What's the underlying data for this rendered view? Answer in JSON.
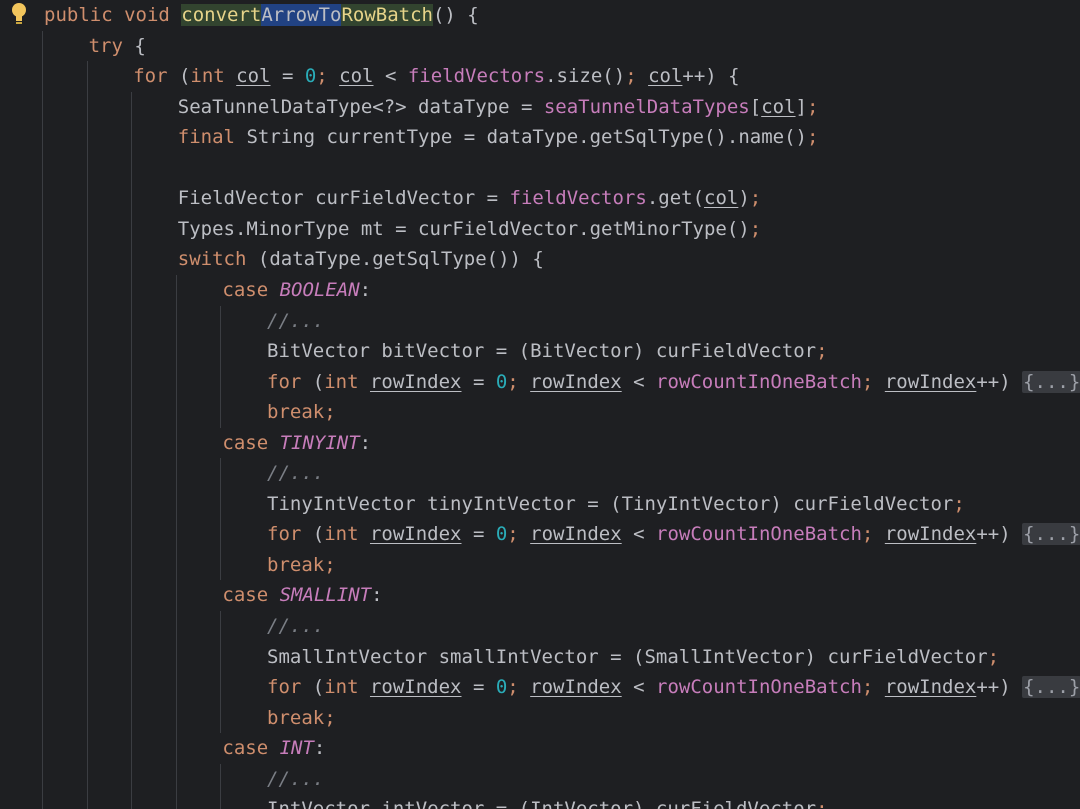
{
  "editor": {
    "lines": [
      {
        "indent": 0,
        "tokens": [
          {
            "t": "public ",
            "c": "kw"
          },
          {
            "t": "void ",
            "c": "kw"
          },
          {
            "t": "convert",
            "c": "m1"
          },
          {
            "t": "ArrowTo",
            "c": "sel"
          },
          {
            "t": "RowBatch",
            "c": "m1"
          },
          {
            "t": "() {",
            "c": ""
          }
        ]
      },
      {
        "indent": 1,
        "tokens": [
          {
            "t": "try ",
            "c": "kw"
          },
          {
            "t": "{",
            "c": ""
          }
        ]
      },
      {
        "indent": 2,
        "tokens": [
          {
            "t": "for ",
            "c": "kw"
          },
          {
            "t": "(",
            "c": ""
          },
          {
            "t": "int ",
            "c": "kw"
          },
          {
            "t": "col",
            "c": "var"
          },
          {
            "t": " = ",
            "c": ""
          },
          {
            "t": "0",
            "c": "num"
          },
          {
            "t": "; ",
            "c": "kw"
          },
          {
            "t": "col",
            "c": "var"
          },
          {
            "t": " < ",
            "c": ""
          },
          {
            "t": "fieldVectors",
            "c": "fld"
          },
          {
            "t": ".size()",
            "c": ""
          },
          {
            "t": "; ",
            "c": "kw"
          },
          {
            "t": "col",
            "c": "var"
          },
          {
            "t": "++) {",
            "c": ""
          }
        ]
      },
      {
        "indent": 3,
        "tokens": [
          {
            "t": "SeaTunnelDataType<?> dataType = ",
            "c": ""
          },
          {
            "t": "seaTunnelDataTypes",
            "c": "fld"
          },
          {
            "t": "[",
            "c": ""
          },
          {
            "t": "col",
            "c": "var"
          },
          {
            "t": "]",
            "c": ""
          },
          {
            "t": ";",
            "c": "kw"
          }
        ]
      },
      {
        "indent": 3,
        "tokens": [
          {
            "t": "final ",
            "c": "kw"
          },
          {
            "t": "String currentType = dataType.getSqlType().name()",
            "c": ""
          },
          {
            "t": ";",
            "c": "kw"
          }
        ]
      },
      {
        "indent": 3,
        "tokens": []
      },
      {
        "indent": 3,
        "tokens": [
          {
            "t": "FieldVector curFieldVector = ",
            "c": ""
          },
          {
            "t": "fieldVectors",
            "c": "fld"
          },
          {
            "t": ".get(",
            "c": ""
          },
          {
            "t": "col",
            "c": "var"
          },
          {
            "t": ")",
            "c": ""
          },
          {
            "t": ";",
            "c": "kw"
          }
        ]
      },
      {
        "indent": 3,
        "tokens": [
          {
            "t": "Types.MinorType mt = curFieldVector.getMinorType()",
            "c": ""
          },
          {
            "t": ";",
            "c": "kw"
          }
        ]
      },
      {
        "indent": 3,
        "tokens": [
          {
            "t": "switch ",
            "c": "kw"
          },
          {
            "t": "(dataType.getSqlType()) {",
            "c": ""
          }
        ]
      },
      {
        "indent": 4,
        "tokens": [
          {
            "t": "case ",
            "c": "kw"
          },
          {
            "t": "BOOLEAN",
            "c": "enum"
          },
          {
            "t": ":",
            "c": ""
          }
        ]
      },
      {
        "indent": 5,
        "tokens": [
          {
            "t": "//...",
            "c": "cmt"
          }
        ]
      },
      {
        "indent": 5,
        "tokens": [
          {
            "t": "BitVector bitVector = (BitVector) curFieldVector",
            "c": ""
          },
          {
            "t": ";",
            "c": "kw"
          }
        ]
      },
      {
        "indent": 5,
        "tokens": [
          {
            "t": "for ",
            "c": "kw"
          },
          {
            "t": "(",
            "c": ""
          },
          {
            "t": "int ",
            "c": "kw"
          },
          {
            "t": "rowIndex",
            "c": "var"
          },
          {
            "t": " = ",
            "c": ""
          },
          {
            "t": "0",
            "c": "num"
          },
          {
            "t": "; ",
            "c": "kw"
          },
          {
            "t": "rowIndex",
            "c": "var"
          },
          {
            "t": " < ",
            "c": ""
          },
          {
            "t": "rowCountInOneBatch",
            "c": "fld"
          },
          {
            "t": "; ",
            "c": "kw"
          },
          {
            "t": "rowIndex",
            "c": "var"
          },
          {
            "t": "++) ",
            "c": ""
          },
          {
            "t": "{...}",
            "c": "fold"
          }
        ]
      },
      {
        "indent": 5,
        "tokens": [
          {
            "t": "break",
            "c": "kw"
          },
          {
            "t": ";",
            "c": "kw"
          }
        ]
      },
      {
        "indent": 4,
        "tokens": [
          {
            "t": "case ",
            "c": "kw"
          },
          {
            "t": "TINYINT",
            "c": "enum"
          },
          {
            "t": ":",
            "c": ""
          }
        ]
      },
      {
        "indent": 5,
        "tokens": [
          {
            "t": "//...",
            "c": "cmt"
          }
        ]
      },
      {
        "indent": 5,
        "tokens": [
          {
            "t": "TinyIntVector tinyIntVector = (TinyIntVector) curFieldVector",
            "c": ""
          },
          {
            "t": ";",
            "c": "kw"
          }
        ]
      },
      {
        "indent": 5,
        "tokens": [
          {
            "t": "for ",
            "c": "kw"
          },
          {
            "t": "(",
            "c": ""
          },
          {
            "t": "int ",
            "c": "kw"
          },
          {
            "t": "rowIndex",
            "c": "var"
          },
          {
            "t": " = ",
            "c": ""
          },
          {
            "t": "0",
            "c": "num"
          },
          {
            "t": "; ",
            "c": "kw"
          },
          {
            "t": "rowIndex",
            "c": "var"
          },
          {
            "t": " < ",
            "c": ""
          },
          {
            "t": "rowCountInOneBatch",
            "c": "fld"
          },
          {
            "t": "; ",
            "c": "kw"
          },
          {
            "t": "rowIndex",
            "c": "var"
          },
          {
            "t": "++) ",
            "c": ""
          },
          {
            "t": "{...}",
            "c": "fold"
          }
        ]
      },
      {
        "indent": 5,
        "tokens": [
          {
            "t": "break",
            "c": "kw"
          },
          {
            "t": ";",
            "c": "kw"
          }
        ]
      },
      {
        "indent": 4,
        "tokens": [
          {
            "t": "case ",
            "c": "kw"
          },
          {
            "t": "SMALLINT",
            "c": "enum"
          },
          {
            "t": ":",
            "c": ""
          }
        ]
      },
      {
        "indent": 5,
        "tokens": [
          {
            "t": "//...",
            "c": "cmt"
          }
        ]
      },
      {
        "indent": 5,
        "tokens": [
          {
            "t": "SmallIntVector smallIntVector = (SmallIntVector) curFieldVector",
            "c": ""
          },
          {
            "t": ";",
            "c": "kw"
          }
        ]
      },
      {
        "indent": 5,
        "tokens": [
          {
            "t": "for ",
            "c": "kw"
          },
          {
            "t": "(",
            "c": ""
          },
          {
            "t": "int ",
            "c": "kw"
          },
          {
            "t": "rowIndex",
            "c": "var"
          },
          {
            "t": " = ",
            "c": ""
          },
          {
            "t": "0",
            "c": "num"
          },
          {
            "t": "; ",
            "c": "kw"
          },
          {
            "t": "rowIndex",
            "c": "var"
          },
          {
            "t": " < ",
            "c": ""
          },
          {
            "t": "rowCountInOneBatch",
            "c": "fld"
          },
          {
            "t": "; ",
            "c": "kw"
          },
          {
            "t": "rowIndex",
            "c": "var"
          },
          {
            "t": "++) ",
            "c": ""
          },
          {
            "t": "{...}",
            "c": "fold"
          }
        ]
      },
      {
        "indent": 5,
        "tokens": [
          {
            "t": "break",
            "c": "kw"
          },
          {
            "t": ";",
            "c": "kw"
          }
        ]
      },
      {
        "indent": 4,
        "tokens": [
          {
            "t": "case ",
            "c": "kw"
          },
          {
            "t": "INT",
            "c": "enum"
          },
          {
            "t": ":",
            "c": ""
          }
        ]
      },
      {
        "indent": 5,
        "tokens": [
          {
            "t": "//...",
            "c": "cmt"
          }
        ]
      },
      {
        "indent": 5,
        "tokens": [
          {
            "t": "IntVector intVector = (IntVector) curFieldVector",
            "c": ""
          },
          {
            "t": ";",
            "c": "kw"
          }
        ]
      }
    ]
  }
}
